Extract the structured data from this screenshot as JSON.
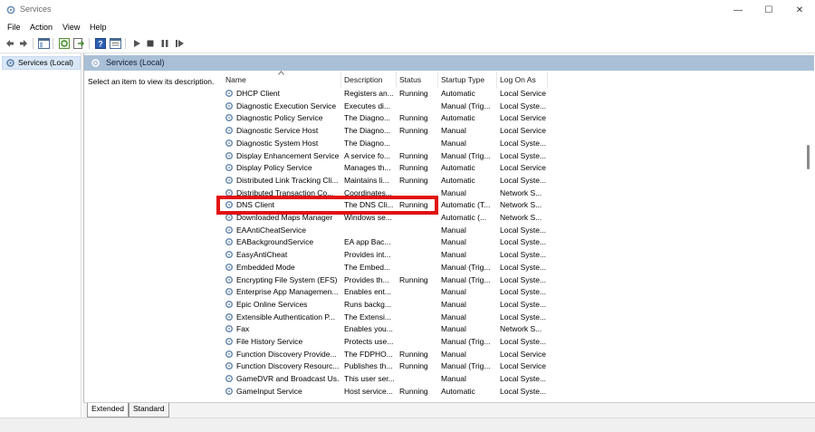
{
  "window": {
    "title": "Services",
    "minimize": "—",
    "maximize": "☐",
    "close": "✕"
  },
  "menu": [
    "File",
    "Action",
    "View",
    "Help"
  ],
  "tree": {
    "root": "Services (Local)"
  },
  "pane": {
    "header": "Services (Local)",
    "description": "Select an item to view its description."
  },
  "columns": [
    "Name",
    "Description",
    "Status",
    "Startup Type",
    "Log On As"
  ],
  "rows": [
    {
      "name": "DHCP Client",
      "description": "Registers an...",
      "status": "Running",
      "startup": "Automatic",
      "logon": "Local Service"
    },
    {
      "name": "Diagnostic Execution Service",
      "description": "Executes di...",
      "status": "",
      "startup": "Manual (Trig...",
      "logon": "Local Syste..."
    },
    {
      "name": "Diagnostic Policy Service",
      "description": "The Diagno...",
      "status": "Running",
      "startup": "Automatic",
      "logon": "Local Service"
    },
    {
      "name": "Diagnostic Service Host",
      "description": "The Diagno...",
      "status": "Running",
      "startup": "Manual",
      "logon": "Local Service"
    },
    {
      "name": "Diagnostic System Host",
      "description": "The Diagno...",
      "status": "",
      "startup": "Manual",
      "logon": "Local Syste..."
    },
    {
      "name": "Display Enhancement Service",
      "description": "A service fo...",
      "status": "Running",
      "startup": "Manual (Trig...",
      "logon": "Local Syste..."
    },
    {
      "name": "Display Policy Service",
      "description": "Manages th...",
      "status": "Running",
      "startup": "Automatic",
      "logon": "Local Service"
    },
    {
      "name": "Distributed Link Tracking Cli...",
      "description": "Maintains li...",
      "status": "Running",
      "startup": "Automatic",
      "logon": "Local Syste..."
    },
    {
      "name": "Distributed Transaction Co...",
      "description": "Coordinates...",
      "status": "",
      "startup": "Manual",
      "logon": "Network S..."
    },
    {
      "name": "DNS Client",
      "description": "The DNS Cli...",
      "status": "Running",
      "startup": "Automatic (T...",
      "logon": "Network S..."
    },
    {
      "name": "Downloaded Maps Manager",
      "description": "Windows se...",
      "status": "",
      "startup": "Automatic (...",
      "logon": "Network S..."
    },
    {
      "name": "EAAntiCheatService",
      "description": "",
      "status": "",
      "startup": "Manual",
      "logon": "Local Syste..."
    },
    {
      "name": "EABackgroundService",
      "description": "EA app Bac...",
      "status": "",
      "startup": "Manual",
      "logon": "Local Syste..."
    },
    {
      "name": "EasyAntiCheat",
      "description": "Provides int...",
      "status": "",
      "startup": "Manual",
      "logon": "Local Syste..."
    },
    {
      "name": "Embedded Mode",
      "description": "The Embed...",
      "status": "",
      "startup": "Manual (Trig...",
      "logon": "Local Syste..."
    },
    {
      "name": "Encrypting File System (EFS)",
      "description": "Provides th...",
      "status": "Running",
      "startup": "Manual (Trig...",
      "logon": "Local Syste..."
    },
    {
      "name": "Enterprise App Managemen...",
      "description": "Enables ent...",
      "status": "",
      "startup": "Manual",
      "logon": "Local Syste..."
    },
    {
      "name": "Epic Online Services",
      "description": "Runs backg...",
      "status": "",
      "startup": "Manual",
      "logon": "Local Syste..."
    },
    {
      "name": "Extensible Authentication P...",
      "description": "The Extensi...",
      "status": "",
      "startup": "Manual",
      "logon": "Local Syste..."
    },
    {
      "name": "Fax",
      "description": "Enables you...",
      "status": "",
      "startup": "Manual",
      "logon": "Network S..."
    },
    {
      "name": "File History Service",
      "description": "Protects use...",
      "status": "",
      "startup": "Manual (Trig...",
      "logon": "Local Syste..."
    },
    {
      "name": "Function Discovery Provide...",
      "description": "The FDPHO...",
      "status": "Running",
      "startup": "Manual",
      "logon": "Local Service"
    },
    {
      "name": "Function Discovery Resourc...",
      "description": "Publishes th...",
      "status": "Running",
      "startup": "Manual (Trig...",
      "logon": "Local Service"
    },
    {
      "name": "GameDVR and Broadcast Us...",
      "description": "This user ser...",
      "status": "",
      "startup": "Manual",
      "logon": "Local Syste..."
    },
    {
      "name": "GameInput Service",
      "description": "Host service...",
      "status": "Running",
      "startup": "Automatic",
      "logon": "Local Syste..."
    }
  ],
  "tabs": [
    "Extended",
    "Standard"
  ],
  "colors": {
    "highlight": "#e21010",
    "pane_header": "#a9bfd6",
    "tree_selected": "#d9e7f7"
  }
}
